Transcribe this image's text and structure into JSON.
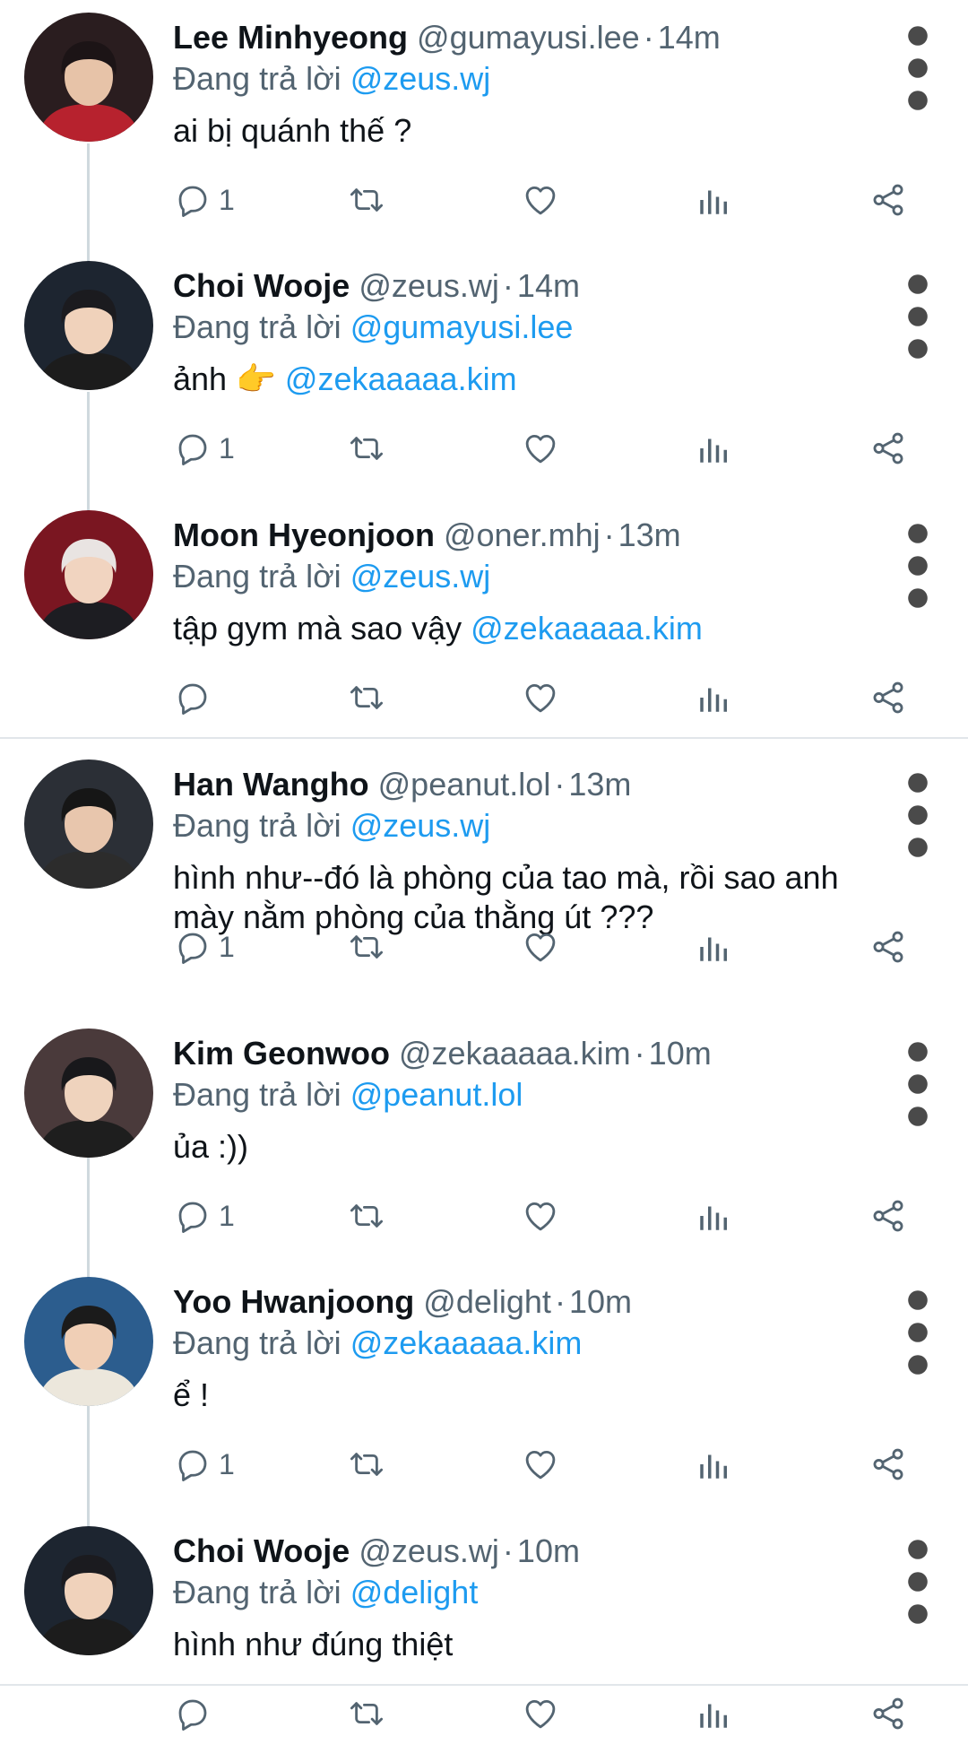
{
  "reply_prefix": "Đang trả lời",
  "icons": {
    "reply": "speech-bubble-icon",
    "retweet": "retweet-arrows-icon",
    "like": "heart-icon",
    "stats": "bar-chart-icon",
    "share": "share-nodes-icon",
    "more": "vertical-dots-icon"
  },
  "colors": {
    "link": "#1d9bf0",
    "muted": "#536471",
    "text": "#0f1419"
  },
  "tweets": [
    {
      "name": "Lee Minhyeong",
      "handle": "@gumayusi.lee",
      "time": "14m",
      "reply_to": "@zeus.wj",
      "text": "ai bị quánh thế ?",
      "mention": "",
      "reply_count": "1"
    },
    {
      "name": "Choi Wooje",
      "handle": "@zeus.wj",
      "time": "14m",
      "reply_to": "@gumayusi.lee",
      "text": "ảnh 👉 ",
      "mention": "@zekaaaaa.kim",
      "reply_count": "1"
    },
    {
      "name": "Moon Hyeonjoon",
      "handle": "@oner.mhj",
      "time": "13m",
      "reply_to": "@zeus.wj",
      "text": "tập gym mà sao vậy ",
      "mention": "@zekaaaaa.kim",
      "reply_count": ""
    },
    {
      "name": "Han Wangho",
      "handle": "@peanut.lol",
      "time": "13m",
      "reply_to": "@zeus.wj",
      "text": "hình như--đó là phòng của tao mà, rồi sao anh mày nằm phòng của thằng út ???",
      "mention": "",
      "reply_count": "1"
    },
    {
      "name": "Kim Geonwoo",
      "handle": "@zekaaaaa.kim",
      "time": "10m",
      "reply_to": "@peanut.lol",
      "text": "ủa :))",
      "mention": "",
      "reply_count": "1"
    },
    {
      "name": "Yoo Hwanjoong",
      "handle": "@delight",
      "time": "10m",
      "reply_to": "@zekaaaaa.kim",
      "text": "ể !",
      "mention": "",
      "reply_count": "1"
    },
    {
      "name": "Choi Wooje",
      "handle": "@zeus.wj",
      "time": "10m",
      "reply_to": "@delight",
      "text": "hình như đúng thiệt",
      "mention": "",
      "reply_count": ""
    }
  ]
}
